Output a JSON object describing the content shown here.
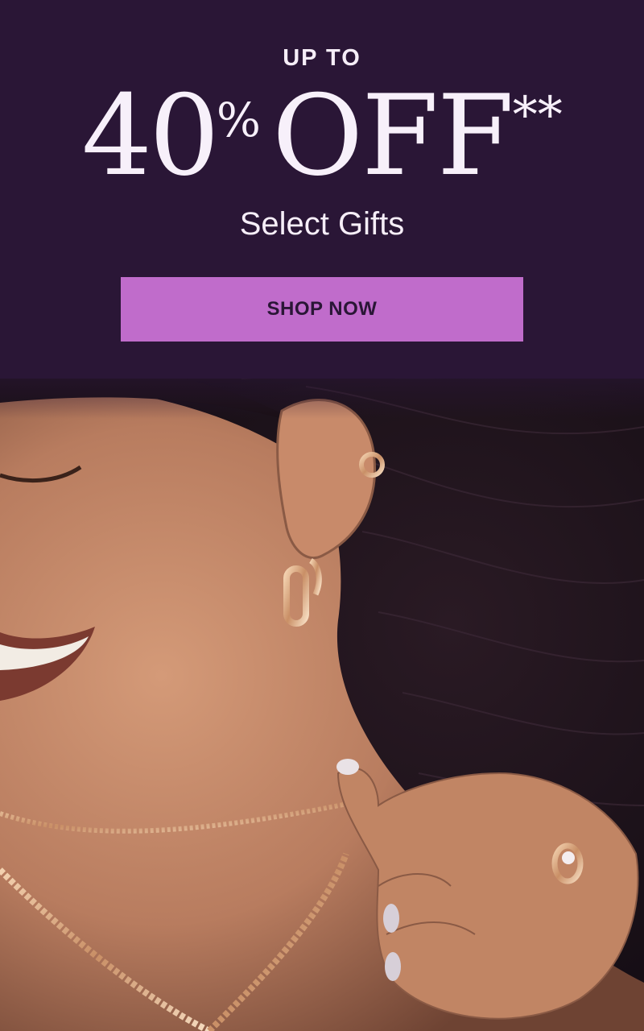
{
  "promo": {
    "eyebrow": "UP TO",
    "headline_number": "40",
    "headline_percent": "%",
    "headline_off": "OFF",
    "headline_asterisks": "**",
    "subheadline": "Select Gifts",
    "cta_label": "SHOP NOW"
  },
  "colors": {
    "background": "#2a1636",
    "cta_background": "#c06ccb",
    "cta_text": "#2a1636",
    "headline_text": "#f7f0fa"
  },
  "image": {
    "alt": "Smiling woman wearing gold hoop earrings, ear cuff, chain necklaces and a ring"
  }
}
